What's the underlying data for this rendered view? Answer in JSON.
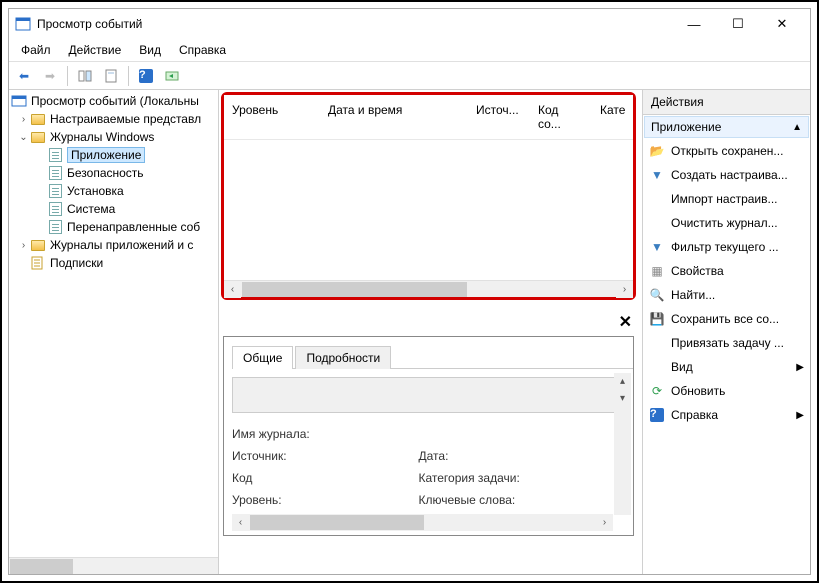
{
  "window": {
    "title": "Просмотр событий"
  },
  "menu": {
    "file": "Файл",
    "action": "Действие",
    "view": "Вид",
    "help": "Справка"
  },
  "tree": {
    "root": "Просмотр событий (Локальны",
    "custom": "Настраиваемые представл",
    "winlogs": "Журналы Windows",
    "application": "Приложение",
    "security": "Безопасность",
    "setup": "Установка",
    "system": "Система",
    "forwarded": "Перенаправленные соб",
    "applogs": "Журналы приложений и с",
    "subs": "Подписки"
  },
  "list": {
    "col_level": "Уровень",
    "col_datetime": "Дата и время",
    "col_source": "Источ...",
    "col_code": "Код со...",
    "col_cat": "Кате"
  },
  "tabs": {
    "general": "Общие",
    "details": "Подробности"
  },
  "det": {
    "logname": "Имя журнала:",
    "source": "Источник:",
    "date": "Дата:",
    "code": "Код",
    "taskcat": "Категория задачи:",
    "level": "Уровень:",
    "keywords": "Ключевые слова:"
  },
  "actions": {
    "title": "Действия",
    "section": "Приложение",
    "open": "Открыть сохранен...",
    "create": "Создать настраива...",
    "import": "Импорт настраив...",
    "clear": "Очистить журнал...",
    "filter": "Фильтр текущего ...",
    "props": "Свойства",
    "find": "Найти...",
    "saveall": "Сохранить все со...",
    "attach": "Привязать задачу ...",
    "view": "Вид",
    "refresh": "Обновить",
    "help": "Справка"
  }
}
